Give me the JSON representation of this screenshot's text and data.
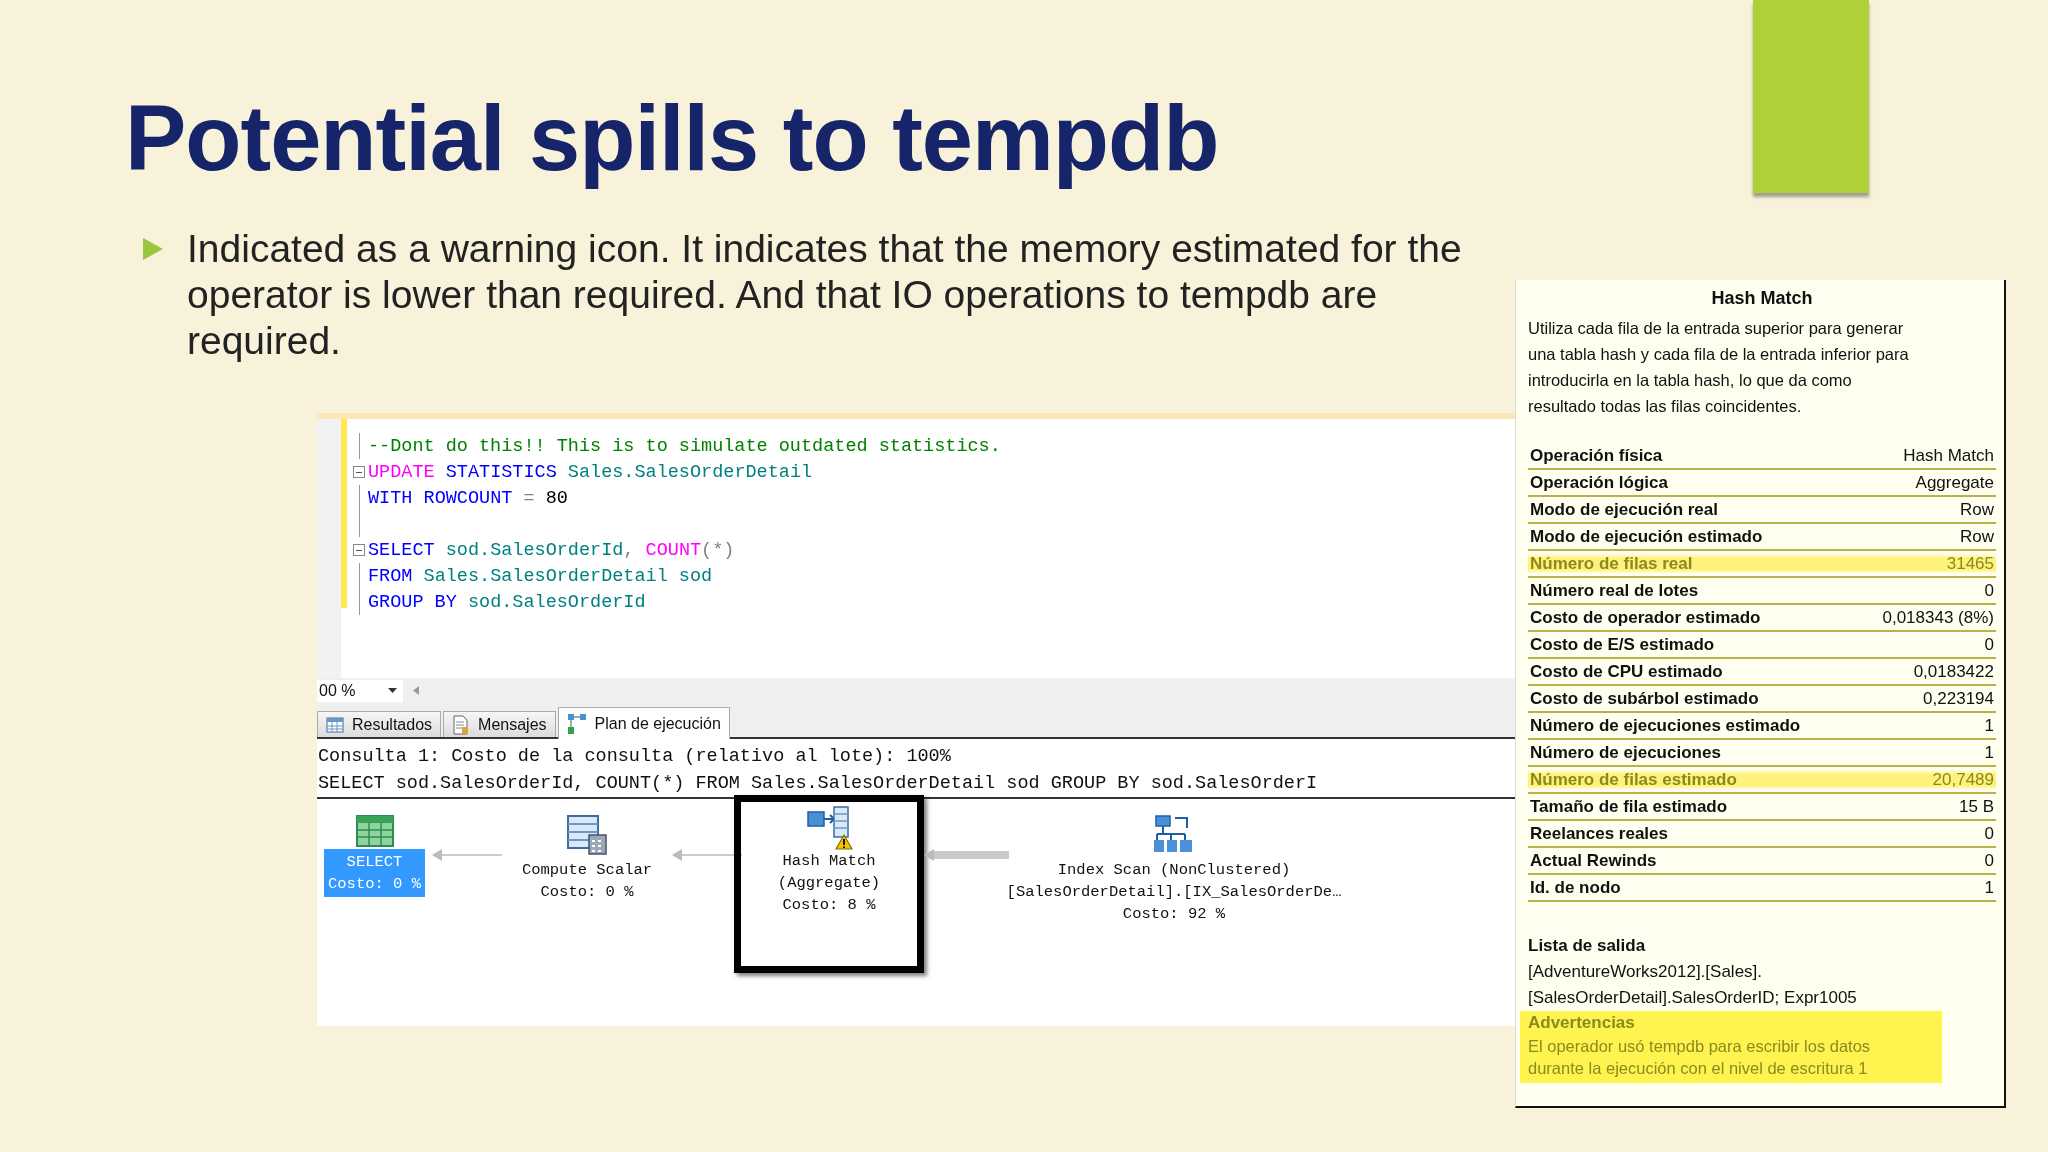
{
  "slide": {
    "title": "Potential spills to tempdb",
    "bullets": [
      "Indicated as a warning icon.  It indicates that the memory estimated for the operator is lower than required. And that IO operations to tempdb are required."
    ]
  },
  "editor": {
    "lines": [
      {
        "fold": false,
        "tokens": [
          {
            "text": "--Dont do this!! This is to simulate outdated statistics.",
            "kind": "comment"
          }
        ]
      },
      {
        "fold": true,
        "tokens": [
          {
            "text": "UPDATE",
            "kind": "function"
          },
          {
            "text": " STATISTICS",
            "kind": "keyword"
          },
          {
            "text": " Sales.SalesOrderDetail",
            "kind": "identifier"
          }
        ]
      },
      {
        "fold": false,
        "tokens": [
          {
            "text": "WITH",
            "kind": "keyword"
          },
          {
            "text": " ROWCOUNT",
            "kind": "keyword"
          },
          {
            "text": " =",
            "kind": "operator"
          },
          {
            "text": " 80",
            "kind": "number"
          }
        ]
      },
      {
        "fold": false
      },
      {
        "fold": true,
        "tokens": [
          {
            "text": "SELECT",
            "kind": "keyword"
          },
          {
            "text": " sod.SalesOrderId",
            "kind": "identifier"
          },
          {
            "text": ",",
            "kind": "operator"
          },
          {
            "text": " COUNT",
            "kind": "function"
          },
          {
            "text": "(*)",
            "kind": "operator"
          }
        ]
      },
      {
        "fold": false,
        "tokens": [
          {
            "text": "FROM",
            "kind": "keyword"
          },
          {
            "text": " Sales.SalesOrderDetail sod",
            "kind": "identifier"
          }
        ]
      },
      {
        "fold": false,
        "tokens": [
          {
            "text": "GROUP BY",
            "kind": "keyword"
          },
          {
            "text": " sod.SalesOrderId",
            "kind": "identifier"
          }
        ]
      }
    ],
    "zoom": "00 %"
  },
  "tabs": [
    {
      "label": "Resultados",
      "kind": "grid",
      "selected": false
    },
    {
      "label": "Mensajes",
      "kind": "document",
      "selected": false
    },
    {
      "label": "Plan de ejecución",
      "kind": "plan",
      "selected": true
    }
  ],
  "plan": {
    "header": [
      "Consulta 1: Costo de la consulta (relativo al lote): 100%",
      "SELECT sod.SalesOrderId, COUNT(*) FROM Sales.SalesOrderDetail sod GROUP BY sod.SalesOrderI"
    ],
    "nodes": [
      {
        "kind": "select",
        "selected": true,
        "warning": false,
        "lines": [
          "SELECT",
          "Costo: 0 %"
        ]
      },
      {
        "kind": "compute",
        "selected": false,
        "warning": false,
        "lines": [
          "Compute Scalar",
          "Costo: 0 %"
        ]
      },
      {
        "kind": "hash",
        "selected": false,
        "warning": true,
        "lines": [
          "Hash Match",
          "(Aggregate)",
          "Costo: 8 %"
        ]
      },
      {
        "kind": "index",
        "selected": false,
        "warning": false,
        "lines": [
          "Index Scan (NonClustered)",
          "[SalesOrderDetail].[IX_SalesOrderDe…",
          "Costo: 92 %"
        ]
      }
    ]
  },
  "tooltip": {
    "title": "Hash Match",
    "description": "Utiliza cada fila de la entrada superior para generar una tabla hash y cada fila de la entrada inferior para introducirla en la tabla hash, lo que da como resultado todas las filas coincidentes.",
    "properties": [
      {
        "label": "Operación física",
        "value": "Hash Match",
        "highlighted": false
      },
      {
        "label": "Operación lógica",
        "value": "Aggregate",
        "highlighted": false
      },
      {
        "label": "Modo de ejecución real",
        "value": "Row",
        "highlighted": false
      },
      {
        "label": "Modo de ejecución estimado",
        "value": "Row",
        "highlighted": false
      },
      {
        "label": "Número de filas real",
        "value": "31465",
        "highlighted": true
      },
      {
        "label": "Número real de lotes",
        "value": "0",
        "highlighted": false
      },
      {
        "label": "Costo de operador estimado",
        "value": "0,018343 (8%)",
        "highlighted": false
      },
      {
        "label": "Costo de E/S estimado",
        "value": "0",
        "highlighted": false
      },
      {
        "label": "Costo de CPU estimado",
        "value": "0,0183422",
        "highlighted": false
      },
      {
        "label": "Costo de subárbol estimado",
        "value": "0,223194",
        "highlighted": false
      },
      {
        "label": "Número de ejecuciones estimado",
        "value": "1",
        "highlighted": false
      },
      {
        "label": "Número de ejecuciones",
        "value": "1",
        "highlighted": false
      },
      {
        "label": "Número de filas estimado",
        "value": "20,7489",
        "highlighted": true
      },
      {
        "label": "Tamaño de fila estimado",
        "value": "15 B",
        "highlighted": false
      },
      {
        "label": "Reelances reales",
        "value": "0",
        "highlighted": false
      },
      {
        "label": "Actual Rewinds",
        "value": "0",
        "highlighted": false
      },
      {
        "label": "Id. de nodo",
        "value": "1",
        "highlighted": false
      }
    ],
    "output_title": "Lista de salida",
    "output_lines": [
      "[AdventureWorks2012].[Sales].",
      "[SalesOrderDetail].SalesOrderID; Expr1005"
    ],
    "warnings": {
      "title": "Advertencias",
      "text": "El operador usó tempdb para escribir los datos durante la ejecución con el nivel de escritura 1",
      "highlighted": true
    }
  }
}
